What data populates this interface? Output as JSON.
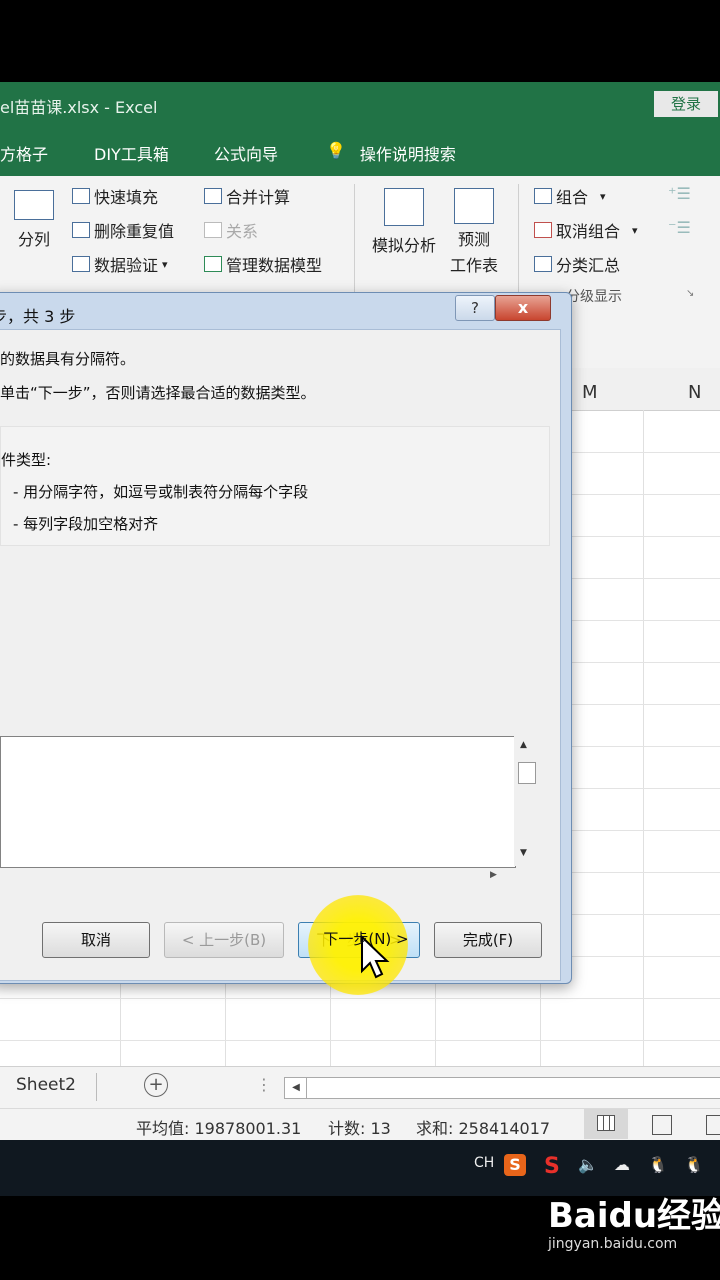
{
  "window": {
    "title": "el苗苗课.xlsx  -  Excel",
    "login_label": "登录"
  },
  "tabs": [
    "方格子",
    "DIY工具箱",
    "公式向导",
    "操作说明搜索"
  ],
  "ribbon": {
    "split_label": "分列",
    "flash_fill": "快速填充",
    "remove_duplicates": "删除重复值",
    "data_validation": "数据验证",
    "consolidate": "合并计算",
    "relationships": "关系",
    "manage_model": "管理数据模型",
    "whatif": "模拟分析",
    "forecast_line1": "预测",
    "forecast_line2": "工作表",
    "group": "组合",
    "ungroup": "取消组合",
    "subtotal": "分类汇总",
    "group_outline_label": "分级显示"
  },
  "columns": [
    "M",
    "N"
  ],
  "dialog": {
    "title": "步，共 3 步",
    "help": "?",
    "close": "x",
    "line1": "的数据具有分隔符。",
    "line2": "单击“下一步”，否则请选择最合适的数据类型。",
    "type_heading": "件类型:",
    "option_delimited": "- 用分隔字符，如逗号或制表符分隔每个字段",
    "option_fixed": "- 每列字段加空格对齐",
    "buttons": {
      "cancel": "取消",
      "back": "< 上一步(B)",
      "next": "下一步(N) >",
      "finish": "完成(F)"
    }
  },
  "sheets": {
    "tab": "Sheet2"
  },
  "status": {
    "average": "平均值: 19878001.31",
    "count": "计数: 13",
    "sum": "求和: 258414017"
  },
  "taskbar": {
    "ime": "CH"
  },
  "watermark": {
    "brand": "Bai⁠du经验",
    "url": "jingyan.baidu.com"
  }
}
